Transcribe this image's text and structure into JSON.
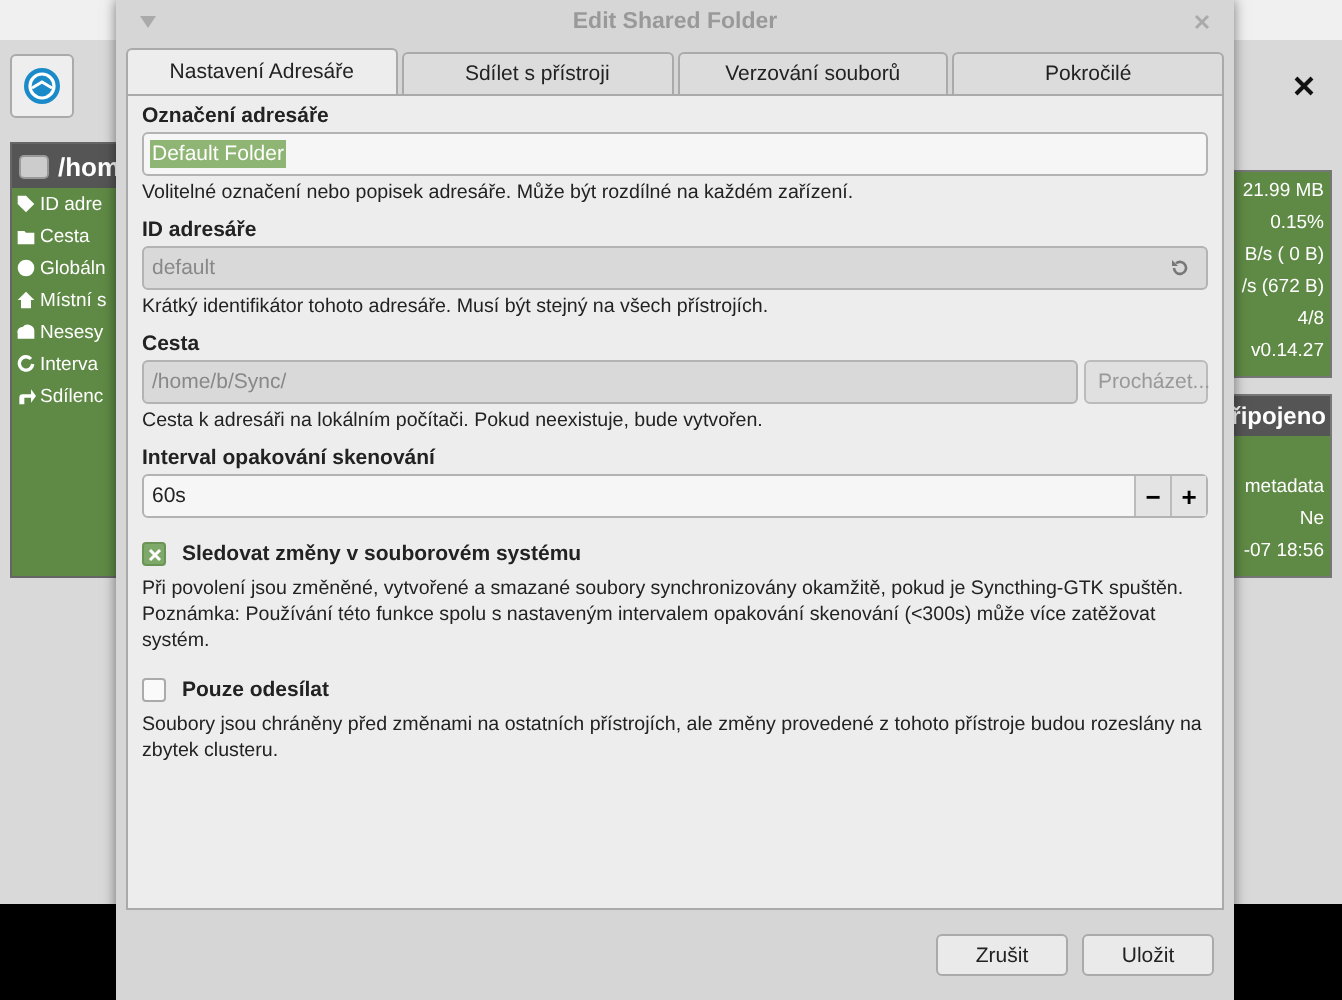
{
  "background": {
    "left_panel": {
      "title": "/hom",
      "rows": [
        {
          "label": "ID adre"
        },
        {
          "label": "Cesta"
        },
        {
          "label": "Globáln"
        },
        {
          "label": "Místní s"
        },
        {
          "label": "Nesesy"
        },
        {
          "label": "Interva"
        },
        {
          "label": "Sdílenc"
        }
      ]
    },
    "right_panel": {
      "values": [
        "21.99 MB",
        "0.15%",
        "B/s (  0 B)",
        "/s (672 B)",
        "4/8",
        "v0.14.27"
      ]
    },
    "status_panel": {
      "title": "řipojeno",
      "values": [
        "metadata",
        "Ne",
        "-07 18:56"
      ]
    }
  },
  "dialog": {
    "title": "Edit Shared Folder",
    "tabs": [
      {
        "label": "Nastavení Adresáře",
        "selected": true
      },
      {
        "label": "Sdílet s přístroji",
        "selected": false
      },
      {
        "label": "Verzování souborů",
        "selected": false
      },
      {
        "label": "Pokročilé",
        "selected": false
      }
    ],
    "fields": [
      {
        "kind": "text",
        "label": "Označení adresáře",
        "value": "Default Folder",
        "text_selected": true,
        "disabled": false,
        "hint": "Volitelné označení nebo popisek adresáře. Může být rozdílné na každém zařízení."
      },
      {
        "kind": "reset",
        "label": "ID adresáře",
        "value": "default",
        "text_selected": false,
        "disabled": true,
        "hint": "Krátký identifikátor tohoto adresáře. Musí být stejný na všech přístrojích."
      },
      {
        "kind": "browse",
        "label": "Cesta",
        "value": "/home/b/Sync/",
        "text_selected": false,
        "disabled": true,
        "button": "Procházet...",
        "hint": "Cesta k adresáři na lokálním počítači. Pokud neexistuje, bude vytvořen."
      },
      {
        "kind": "spin",
        "label": "Interval opakování skenování",
        "value": "60s",
        "text_selected": false,
        "disabled": false,
        "minus": "−",
        "plus": "+"
      }
    ],
    "checkboxes": [
      {
        "label": "Sledovat změny v souborovém systému",
        "checked": true,
        "description": [
          "Při povolení jsou změněné, vytvořené a smazané soubory synchronizovány okamžitě, pokud je Syncthing-GTK spuštěn.",
          "Poznámka: Používání této funkce spolu s nastaveným intervalem opakování skenování (<300s) může více zatěžovat systém."
        ]
      },
      {
        "label": "Pouze odesílat",
        "checked": false,
        "description": [
          "Soubory jsou chráněny před změnami na ostatních přístrojích, ale změny provedené z tohoto přístroje budou rozeslány na zbytek clusteru."
        ]
      }
    ],
    "buttons": [
      "Zrušit",
      "Uložit"
    ]
  }
}
